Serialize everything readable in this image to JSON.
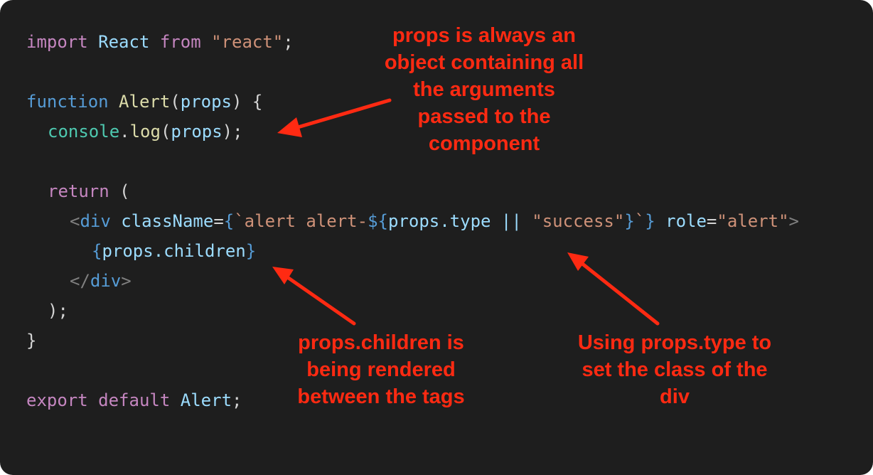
{
  "code": {
    "line1": {
      "import": "import",
      "react": "React",
      "from": "from",
      "module": "\"react\"",
      "semi": ";"
    },
    "line3": {
      "function": "function",
      "name": "Alert",
      "open_paren": "(",
      "param": "props",
      "close": ") {"
    },
    "line4": {
      "console": "console",
      "dot": ".",
      "log": "log",
      "open": "(",
      "arg": "props",
      "close": ");"
    },
    "line6": {
      "return": "return",
      "paren": " ("
    },
    "line7": {
      "lt": "<",
      "tag": "div",
      "attr": "className",
      "eq": "=",
      "brace_open": "{",
      "template_start": "`alert alert-",
      "interp_open": "${",
      "expr": "props.type || ",
      "default_str": "\"success\"",
      "interp_close": "}",
      "template_end": "`",
      "brace_close": "}",
      "role_attr": "role",
      "role_eq": "=",
      "role_val": "\"alert\"",
      "gt": ">"
    },
    "line8": {
      "brace_open": "{",
      "expr": "props.children",
      "brace_close": "}"
    },
    "line9": {
      "close_tag_open": "</",
      "tag": "div",
      "gt": ">"
    },
    "line10": {
      "text": ");"
    },
    "line11": {
      "text": "}"
    },
    "line13": {
      "export": "export",
      "default": "default",
      "name": "Alert",
      "semi": ";"
    }
  },
  "annotations": {
    "props_object": [
      "props is always an",
      "object containing all",
      "the arguments",
      "passed to the",
      "component"
    ],
    "children": [
      "props.children is",
      "being rendered",
      "between the tags"
    ],
    "type": [
      "Using props.type to",
      "set the class of the",
      "div"
    ]
  },
  "colors": {
    "background": "#1e1e1e",
    "annotation": "#ff2a12",
    "keyword_purple": "#c586c0",
    "keyword_blue": "#569cd6",
    "identifier": "#9cdcfe",
    "function": "#dcdcaa",
    "class": "#4ec9b0",
    "string": "#ce9178"
  }
}
